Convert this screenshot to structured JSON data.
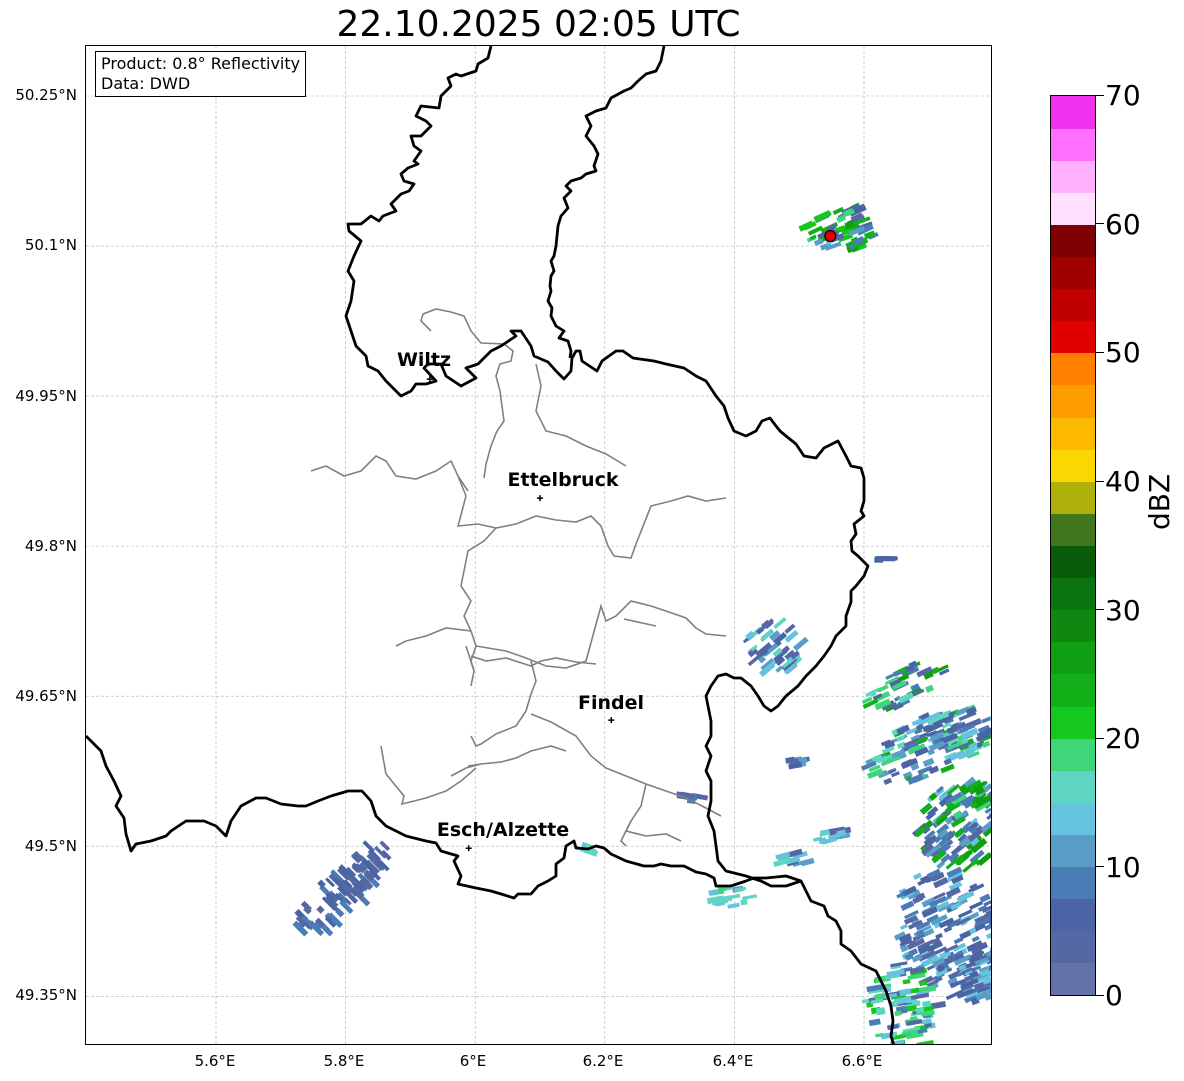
{
  "title": "22.10.2025 02:05 UTC",
  "info": {
    "product": "Product: 0.8° Reflectivity",
    "data": "Data: DWD"
  },
  "lat_labels": [
    "50.25°N",
    "50.1°N",
    "49.95°N",
    "49.8°N",
    "49.65°N",
    "49.5°N",
    "49.35°N"
  ],
  "lon_labels": [
    "5.6°E",
    "5.8°E",
    "6°E",
    "6.2°E",
    "6.4°E",
    "6.6°E"
  ],
  "cities": [
    {
      "name": "Wiltz",
      "lon": 5.93,
      "lat": 49.967
    },
    {
      "name": "Ettelbruck",
      "lon": 6.1,
      "lat": 49.848
    },
    {
      "name": "Findel",
      "lon": 6.21,
      "lat": 49.626
    },
    {
      "name": "Esch/Alzette",
      "lon": 5.99,
      "lat": 49.498
    }
  ],
  "radar_site": {
    "lon": 6.548,
    "lat": 50.11,
    "color": "#e00000"
  },
  "colorbar": {
    "label": "dBZ",
    "ticks": [
      "0",
      "10",
      "20",
      "30",
      "40",
      "50",
      "60",
      "70"
    ],
    "min": 0,
    "max": 70,
    "colors": [
      "#6373a7",
      "#5668a3",
      "#4a64a6",
      "#4a7cb6",
      "#5a9ec8",
      "#66c3dd",
      "#5fd6c3",
      "#3fd67a",
      "#14c81e",
      "#12b018",
      "#109e12",
      "#0e8810",
      "#0a7410",
      "#0a5c0a",
      "#42761c",
      "#b0b00a",
      "#fbd600",
      "#fdb800",
      "#ff9c00",
      "#ff7f00",
      "#e00000",
      "#c00000",
      "#a00000",
      "#7e0000",
      "#ffe0ff",
      "#ffb0ff",
      "#ff70ff",
      "#ee32ee"
    ]
  },
  "colors": {
    "border": "#000000",
    "cantons": "#808080",
    "grid": "#b0b0b0"
  }
}
